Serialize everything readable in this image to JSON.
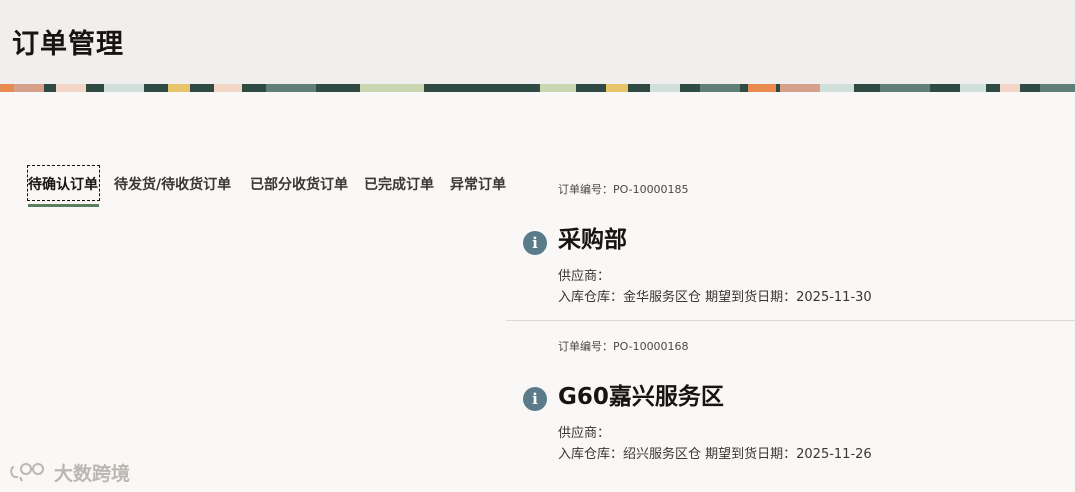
{
  "page": {
    "title": "订单管理"
  },
  "banner": {
    "colors": [
      "#2f4b43",
      "#e98a4e",
      "#cfe0da",
      "#d6a08a",
      "#f2d7c9",
      "#5f7f78",
      "#c9d7b2",
      "#e7c36b"
    ]
  },
  "tabs": [
    {
      "label": "待确认订单",
      "active": true
    },
    {
      "label": "待发货/待收货订单",
      "active": false
    },
    {
      "label": "已部分收货订单",
      "active": false
    },
    {
      "label": "已完成订单",
      "active": false
    },
    {
      "label": "异常订单",
      "active": false
    }
  ],
  "orders": [
    {
      "order_no": "订单编号：PO-10000185",
      "icon": "info-icon",
      "title": "采购部",
      "supplier": "供应商：",
      "warehouse_line": "入库仓库：金华服务区仓 期望到货日期：2025-11-30"
    },
    {
      "order_no": "订单编号：PO-10000168",
      "icon": "info-icon",
      "title": "G60嘉兴服务区",
      "supplier": "供应商：",
      "warehouse_line": "入库仓库：绍兴服务区仓 期望到货日期：2025-11-26"
    }
  ],
  "watermark": {
    "text": "大数跨境"
  }
}
